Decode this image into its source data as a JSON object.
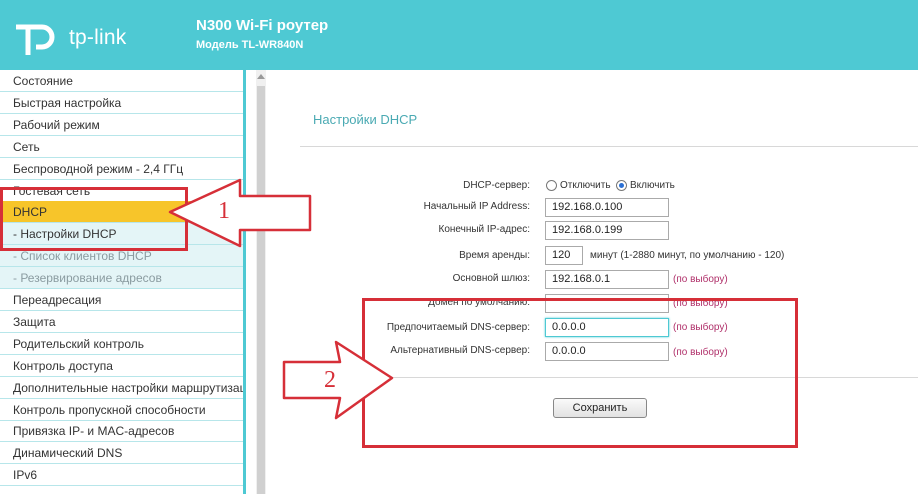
{
  "header": {
    "brand": "tp-link",
    "title": "N300 Wi-Fi роутер",
    "model": "Модель TL-WR840N",
    "bg_color": "#4ec9d3"
  },
  "sidebar": {
    "items": [
      {
        "label": "Состояние",
        "type": "main"
      },
      {
        "label": "Быстрая настройка",
        "type": "main"
      },
      {
        "label": "Рабочий режим",
        "type": "main"
      },
      {
        "label": "Сеть",
        "type": "main"
      },
      {
        "label": "Беспроводной режим - 2,4 ГГц",
        "type": "main"
      },
      {
        "label": "Гостевая сеть",
        "type": "main"
      },
      {
        "label": "DHCP",
        "type": "active"
      },
      {
        "label": "- Настройки DHCP",
        "type": "sub"
      },
      {
        "label": "- Список клиентов DHCP",
        "type": "sub-dim"
      },
      {
        "label": "- Резервирование адресов",
        "type": "sub-dim"
      },
      {
        "label": "Переадресация",
        "type": "main"
      },
      {
        "label": "Защита",
        "type": "main"
      },
      {
        "label": "Родительский контроль",
        "type": "main"
      },
      {
        "label": "Контроль доступа",
        "type": "main"
      },
      {
        "label": "Дополнительные настройки маршрутизации",
        "type": "main"
      },
      {
        "label": "Контроль пропускной способности",
        "type": "main"
      },
      {
        "label": "Привязка IP- и MAC-адресов",
        "type": "main"
      },
      {
        "label": "Динамический DNS",
        "type": "main"
      },
      {
        "label": "IPv6",
        "type": "main"
      }
    ]
  },
  "content": {
    "page_title": "Настройки DHCP",
    "dhcp_server": {
      "label": "DHCP-сервер:",
      "option_off": "Отключить",
      "option_on": "Включить",
      "selected": "Включить"
    },
    "start_ip": {
      "label": "Начальный IP Address:",
      "value": "192.168.0.100"
    },
    "end_ip": {
      "label": "Конечный IP-адрес:",
      "value": "192.168.0.199"
    },
    "lease": {
      "label": "Время аренды:",
      "value": "120",
      "hint": "минут (1-2880 минут, по умолчанию - 120)"
    },
    "gateway": {
      "label": "Основной шлюз:",
      "value": "192.168.0.1",
      "optional": "(по выбору)"
    },
    "domain": {
      "label": "Домен по умолчанию:",
      "value": "",
      "optional": "(по выбору)"
    },
    "dns1": {
      "label": "Предпочитаемый DNS-сервер:",
      "value": "0.0.0.0",
      "optional": "(по выбору)"
    },
    "dns2": {
      "label": "Альтернативный DNS-сервер:",
      "value": "0.0.0.0",
      "optional": "(по выбору)"
    },
    "save_label": "Сохранить"
  },
  "annotations": {
    "num1": "1",
    "num2": "2",
    "color": "#d62f38"
  }
}
